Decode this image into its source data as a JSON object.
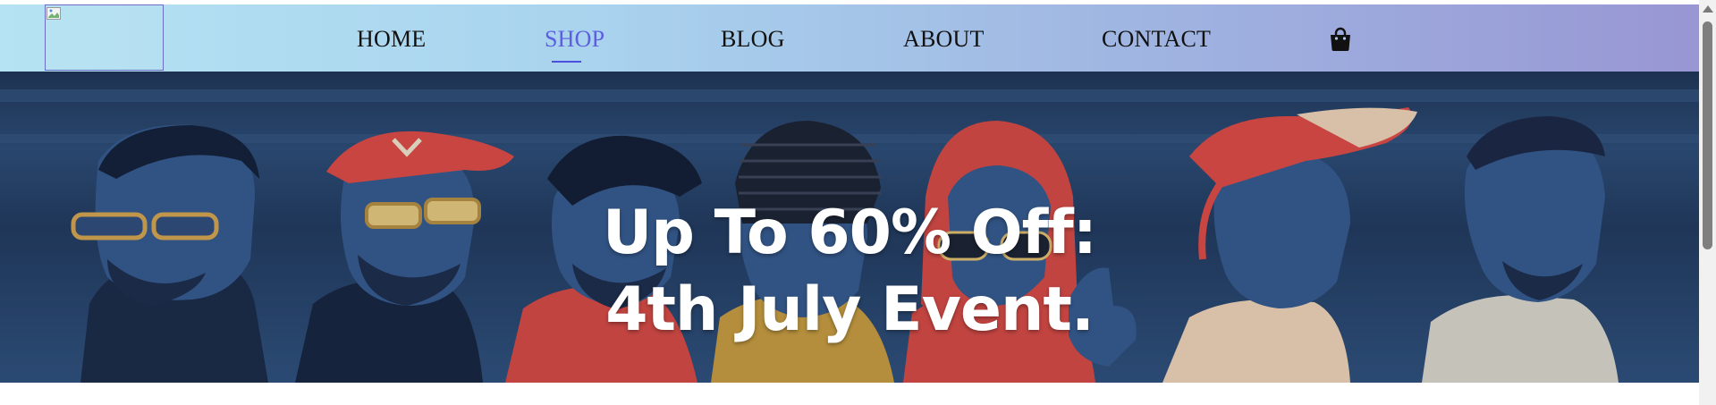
{
  "nav": {
    "items": [
      {
        "label": "HOME",
        "active": false
      },
      {
        "label": "SHOP",
        "active": true
      },
      {
        "label": "BLOG",
        "active": false
      },
      {
        "label": "ABOUT",
        "active": false
      },
      {
        "label": "CONTACT",
        "active": false
      }
    ],
    "cart_icon": "shopping-bag-icon",
    "active_color": "#5b5fe0"
  },
  "logo": {
    "icon": "broken-image-icon"
  },
  "hero": {
    "line1": "Up To 60% Off:",
    "line2": "4th July Event.",
    "background_color": "#2a4a73",
    "accent_color": "#e0483f"
  }
}
